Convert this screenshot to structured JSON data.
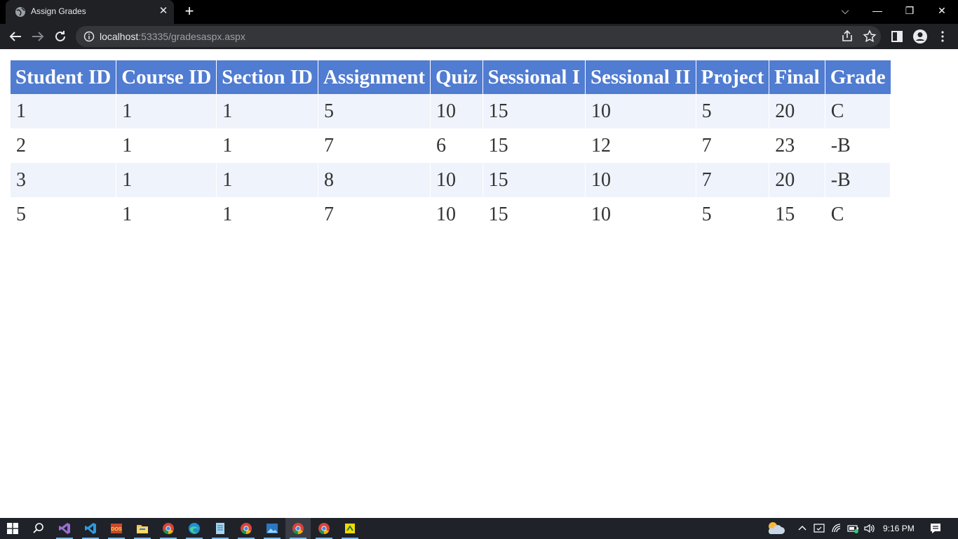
{
  "browser": {
    "tab_title": "Assign Grades",
    "url_host": "localhost",
    "url_rest": ":53335/gradesaspx.aspx"
  },
  "table": {
    "headers": [
      "Student ID",
      "Course ID",
      "Section ID",
      "Assignment",
      "Quiz",
      "Sessional I",
      "Sessional II",
      "Project",
      "Final",
      "Grade"
    ],
    "rows": [
      [
        "1",
        "1",
        "1",
        "5",
        "10",
        "15",
        "10",
        "5",
        "20",
        "C"
      ],
      [
        "2",
        "1",
        "1",
        "7",
        "6",
        "15",
        "12",
        "7",
        "23",
        "-B"
      ],
      [
        "3",
        "1",
        "1",
        "8",
        "10",
        "15",
        "10",
        "7",
        "20",
        "-B"
      ],
      [
        "5",
        "1",
        "1",
        "7",
        "10",
        "15",
        "10",
        "5",
        "15",
        "C"
      ]
    ]
  },
  "colors": {
    "header_bg": "#507cd1",
    "alt_row_bg": "#eff3fb"
  },
  "taskbar": {
    "time": "9:16 PM",
    "apps": [
      "start-icon",
      "search-icon",
      "visual-studio-icon",
      "vscode-icon",
      "dosbox-icon",
      "file-explorer-icon",
      "chrome-icon",
      "edge-icon",
      "notepad-icon",
      "chrome-icon",
      "photos-icon",
      "chrome-icon",
      "chrome-icon",
      "sticky-app-icon"
    ]
  }
}
